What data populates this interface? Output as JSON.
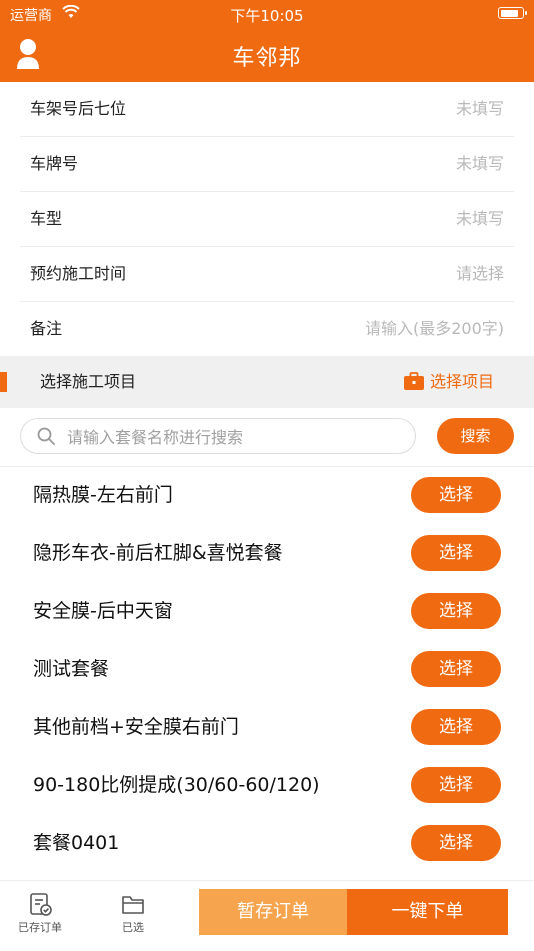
{
  "status_bar": {
    "carrier": "运营商",
    "time": "下午10:05"
  },
  "header": {
    "title": "车邻邦"
  },
  "form": {
    "rows": [
      {
        "label": "车架号后七位",
        "value": "未填写"
      },
      {
        "label": "车牌号",
        "value": "未填写"
      },
      {
        "label": "车型",
        "value": "未填写"
      },
      {
        "label": "预约施工时间",
        "value": "请选择"
      },
      {
        "label": "备注",
        "value": "请输入(最多200字)"
      }
    ]
  },
  "section": {
    "title": "选择施工项目",
    "pick_label": "选择项目"
  },
  "search": {
    "placeholder": "请输入套餐名称进行搜索",
    "button": "搜索"
  },
  "packages": [
    {
      "name": "隔热膜-左右前门",
      "button": "选择"
    },
    {
      "name": "隐形车衣-前后杠脚&喜悦套餐",
      "button": "选择"
    },
    {
      "name": "安全膜-后中天窗",
      "button": "选择"
    },
    {
      "name": "测试套餐",
      "button": "选择"
    },
    {
      "name": "其他前档+安全膜右前门",
      "button": "选择"
    },
    {
      "name": "90-180比例提成(30/60-60/120)",
      "button": "选择"
    },
    {
      "name": "套餐0401",
      "button": "选择"
    }
  ],
  "footer": {
    "saved_orders": "已存订单",
    "selected": "已选",
    "save_order": "暂存订单",
    "place_order": "一键下单"
  },
  "colors": {
    "primary": "#ef6a10",
    "secondary": "#f6a44e"
  },
  "icons": [
    "user-icon",
    "wifi-icon",
    "battery-icon",
    "briefcase-icon",
    "search-icon",
    "saved-orders-icon",
    "folder-icon"
  ]
}
